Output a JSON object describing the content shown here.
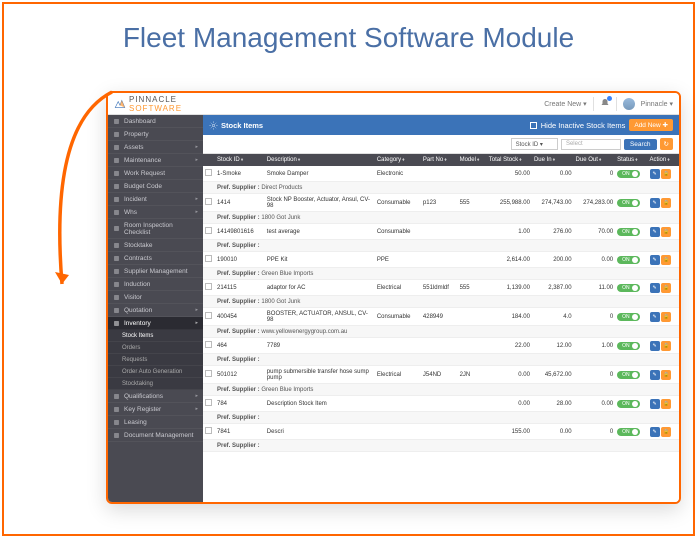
{
  "page_title": "Fleet Management Software Module",
  "brand": {
    "line1": "PINNACLE",
    "line2": "SOFTWARE"
  },
  "topnav": {
    "create": "Create New",
    "user": "Pinnacle"
  },
  "sidebar": [
    {
      "label": "Dashboard",
      "icon": "speed"
    },
    {
      "label": "Property",
      "icon": "building"
    },
    {
      "label": "Assets",
      "icon": "car",
      "caret": true
    },
    {
      "label": "Maintenance",
      "icon": "wrench",
      "caret": true
    },
    {
      "label": "Work Request",
      "icon": "clipboard"
    },
    {
      "label": "Budget Code",
      "icon": "briefcase"
    },
    {
      "label": "Incident",
      "icon": "flag",
      "caret": true
    },
    {
      "label": "Whs",
      "icon": "hardhat",
      "caret": true
    },
    {
      "label": "Room Inspection Checklist",
      "icon": "key"
    },
    {
      "label": "Stocktake",
      "icon": "box"
    },
    {
      "label": "Contracts",
      "icon": "doc"
    },
    {
      "label": "Supplier Management",
      "icon": "truck"
    },
    {
      "label": "Induction",
      "icon": "grad"
    },
    {
      "label": "Visitor",
      "icon": "badge"
    },
    {
      "label": "Quotation",
      "icon": "quote",
      "caret": true
    },
    {
      "label": "Inventory",
      "icon": "cubes",
      "caret": true,
      "active": true
    },
    {
      "label": "Stock Items",
      "sub": true,
      "active": true
    },
    {
      "label": "Orders",
      "sub": true
    },
    {
      "label": "Requests",
      "sub": true
    },
    {
      "label": "Order Auto Generation",
      "sub": true
    },
    {
      "label": "Stocktaking",
      "sub": true
    },
    {
      "label": "Qualifications",
      "icon": "star",
      "caret": true
    },
    {
      "label": "Key Register",
      "icon": "key",
      "caret": true
    },
    {
      "label": "Leasing",
      "icon": "home"
    },
    {
      "label": "Document Management",
      "icon": "folder"
    }
  ],
  "header": {
    "title": "Stock Items",
    "hide_label": "Hide Inactive Stock Items",
    "add": "Add New"
  },
  "filter": {
    "field": "Stock ID",
    "select": "Select",
    "search": "Search"
  },
  "columns": [
    "Stock ID",
    "Description",
    "Category",
    "Part No",
    "Model",
    "Total Stock",
    "Due In",
    "Due Out",
    "Status",
    "Action"
  ],
  "pref_label": "Pref. Supplier :",
  "status_on": "ON",
  "rows": [
    {
      "id": "1-Smoke",
      "desc": "Smoke Damper",
      "cat": "Electronic",
      "part": "",
      "model": "",
      "total": "50.00",
      "in": "0.00",
      "out": "0",
      "supplier": "Direct Products"
    },
    {
      "id": "1414",
      "desc": "Stock NP Booster, Actuator, Ansul, CV-98",
      "cat": "Consumable",
      "part": "p123",
      "model": "555",
      "total": "255,988.00",
      "in": "274,743.00",
      "out": "274,283.00",
      "supplier": "1800 Got Junk"
    },
    {
      "id": "14149801616",
      "desc": "test average",
      "cat": "Consumable",
      "part": "",
      "model": "",
      "total": "1.00",
      "in": "276.00",
      "out": "70.00",
      "supplier": "",
      "show_actions": true
    },
    {
      "id": "190010",
      "desc": "PPE Kit",
      "cat": "PPE",
      "part": "",
      "model": "",
      "total": "2,614.00",
      "in": "200.00",
      "out": "0.00",
      "supplier": "Green Blue Imports",
      "show_actions": true
    },
    {
      "id": "214115",
      "desc": "adaptor for AC",
      "cat": "Electrical",
      "part": "551ldmldf",
      "model": "555",
      "total": "1,139.00",
      "in": "2,387.00",
      "out": "11.00",
      "supplier": "1800 Got Junk"
    },
    {
      "id": "400454",
      "desc": "BOOSTER, ACTUATOR, ANSUL, CV-98",
      "cat": "Consumable",
      "part": "428949",
      "model": "",
      "total": "184.00",
      "in": "4.0",
      "out": "0",
      "supplier": "www.yellowenergygroup.com.au"
    },
    {
      "id": "464",
      "desc": "7789",
      "cat": "",
      "part": "",
      "model": "",
      "total": "22.00",
      "in": "12.00",
      "out": "1.00",
      "supplier": ""
    },
    {
      "id": "501012",
      "desc": "pump submersible transfer hose sump pump",
      "cat": "Electrical",
      "part": "J54ND",
      "model": "2JN",
      "total": "0.00",
      "in": "45,672.00",
      "out": "0",
      "supplier": "Green Blue Imports"
    },
    {
      "id": "784",
      "desc": "Description Stock Item",
      "cat": "",
      "part": "",
      "model": "",
      "total": "0.00",
      "in": "28.00",
      "out": "0.00",
      "supplier": ""
    },
    {
      "id": "7841",
      "desc": "Descri",
      "cat": "",
      "part": "",
      "model": "",
      "total": "155.00",
      "in": "0.00",
      "out": "0",
      "supplier": ""
    }
  ]
}
